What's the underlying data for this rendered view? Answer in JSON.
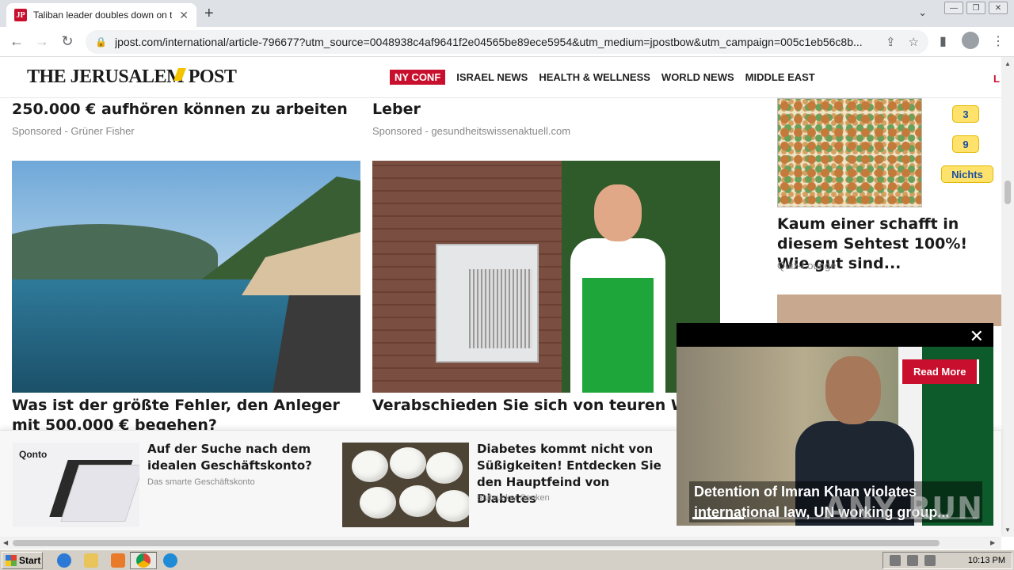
{
  "browser": {
    "tab_title": "Taliban leader doubles down on treat",
    "favicon_text": "JP",
    "url": "jpost.com/international/article-796677?utm_source=0048938c4af9641f2e04565be89ece5954&utm_medium=jpostbow&utm_campaign=005c1eb56c8b..."
  },
  "site": {
    "logo": "THE JERUSALEM POST",
    "nav": [
      "NY CONF",
      "ISRAEL NEWS",
      "HEALTH & WELLNESS",
      "WORLD NEWS",
      "MIDDLE EAST"
    ],
    "nav_cut": "L"
  },
  "articles": {
    "top_left_title": "250.000 € aufhören können zu arbeiten",
    "top_left_sponsor": "Sponsored - Grüner Fisher",
    "top_mid_title": "Leber",
    "top_mid_sponsor": "Sponsored - gesundheitswissenaktuell.com",
    "card1_title": "Was ist der größte Fehler, den Anleger mit 500.000 € begehen?",
    "card2_title": "Verabschieden Sie sich von teuren Wärmepumpen (wenn Sie ein Haus besitz..."
  },
  "right_column": {
    "options": [
      "3",
      "9",
      "Nichts"
    ],
    "quiz_title": "Kaum einer schafft in diesem Sehtest 100%! Wie gut sind...",
    "quiz_source": "Quiz-Lounge"
  },
  "ad_bar": {
    "ad1_brand": "Qonto",
    "ad1_title": "Auf der Suche nach dem idealen Geschäftskonto?",
    "ad1_source": "Das smarte Geschäftskonto",
    "ad2_title": "Diabetes kommt nicht von Süßigkeiten! Entdecken Sie den Hauptfeind von Diabetes",
    "ad2_source": "Blutzucker Senken"
  },
  "video_popup": {
    "close": "✕",
    "read_more": "Read More",
    "caption": "Detention of Imran Khan violates international law, UN working group...",
    "progress": 0.18
  },
  "watermark": "ANY RUN",
  "taskbar": {
    "start_label": "Start",
    "clock": "10:13 PM"
  }
}
